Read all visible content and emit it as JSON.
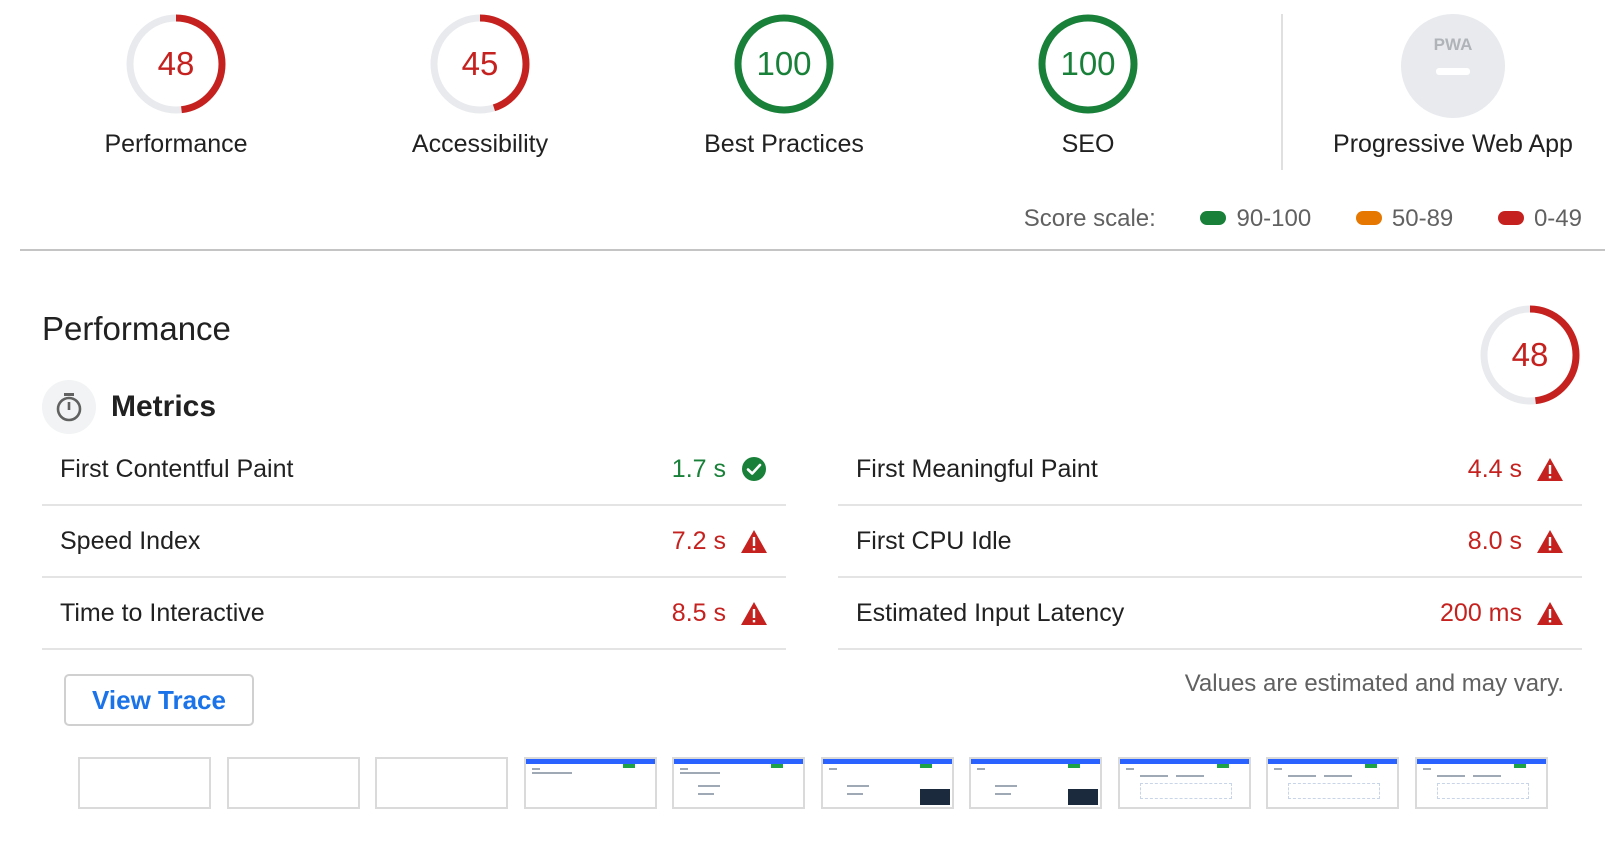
{
  "categories": [
    {
      "label": "Performance",
      "score": "48",
      "fraction": 0.48,
      "color": "#c5221f"
    },
    {
      "label": "Accessibility",
      "score": "45",
      "fraction": 0.45,
      "color": "#c5221f"
    },
    {
      "label": "Best Practices",
      "score": "100",
      "fraction": 1.0,
      "color": "#188038"
    },
    {
      "label": "SEO",
      "score": "100",
      "fraction": 1.0,
      "color": "#188038"
    },
    {
      "label": "Progressive Web App",
      "badge": "PWA"
    }
  ],
  "scale": {
    "label": "Score scale:",
    "ranges": [
      {
        "text": "90-100",
        "color": "#188038"
      },
      {
        "text": "50-89",
        "color": "#e67700"
      },
      {
        "text": "0-49",
        "color": "#c5221f"
      }
    ]
  },
  "performance": {
    "title": "Performance",
    "score": "48",
    "fraction": 0.48,
    "metrics_title": "Metrics",
    "metrics": [
      {
        "name": "First Contentful Paint",
        "value": "1.7 s",
        "status": "pass"
      },
      {
        "name": "First Meaningful Paint",
        "value": "4.4 s",
        "status": "fail"
      },
      {
        "name": "Speed Index",
        "value": "7.2 s",
        "status": "fail"
      },
      {
        "name": "First CPU Idle",
        "value": "8.0 s",
        "status": "fail"
      },
      {
        "name": "Time to Interactive",
        "value": "8.5 s",
        "status": "fail"
      },
      {
        "name": "Estimated Input Latency",
        "value": "200 ms",
        "status": "fail"
      }
    ],
    "view_trace_label": "View Trace",
    "estimate_note": "Values are estimated and may vary."
  },
  "colors": {
    "pass": "#188038",
    "fail": "#c5221f",
    "link": "#1a73e8"
  }
}
